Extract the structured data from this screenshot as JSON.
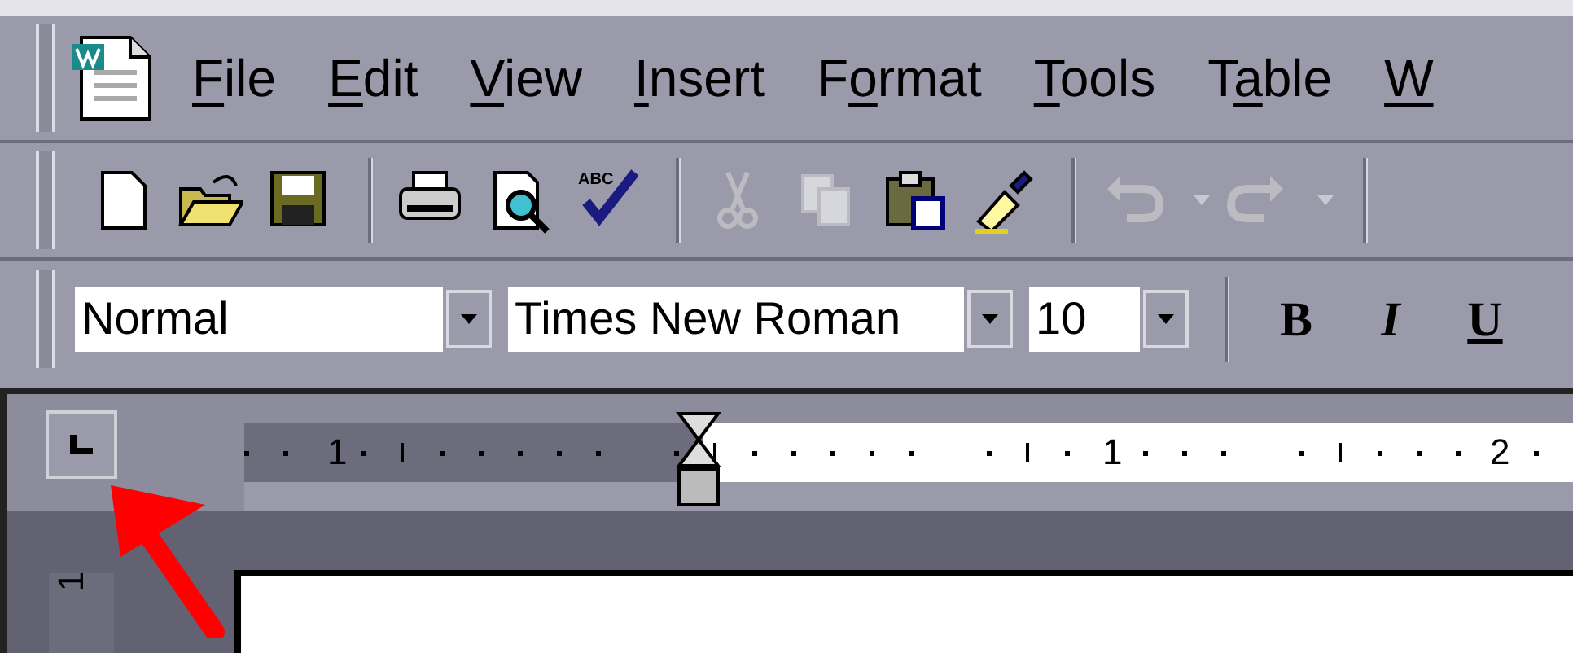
{
  "menu_bar": [
    {
      "key": "F",
      "after": "ile"
    },
    {
      "key": "E",
      "after": "dit"
    },
    {
      "key": "V",
      "after": "iew"
    },
    {
      "key": "I",
      "after": "nsert"
    },
    {
      "before": "F",
      "key": "o",
      "after": "rmat"
    },
    {
      "key": "T",
      "after": "ools"
    },
    {
      "before": "T",
      "key": "a",
      "after": "ble"
    },
    {
      "key": "W"
    }
  ],
  "standard_toolbar": [
    {
      "kind": "new",
      "disabled": false
    },
    {
      "kind": "open",
      "disabled": false
    },
    {
      "kind": "save",
      "disabled": false
    },
    {
      "kind": "separator"
    },
    {
      "kind": "print",
      "disabled": false
    },
    {
      "kind": "preview",
      "disabled": false
    },
    {
      "kind": "spelling",
      "disabled": false,
      "text": "ABC"
    },
    {
      "kind": "separator"
    },
    {
      "kind": "cut",
      "disabled": true
    },
    {
      "kind": "copy",
      "disabled": true
    },
    {
      "kind": "paste",
      "disabled": false
    },
    {
      "kind": "brush",
      "disabled": false
    },
    {
      "kind": "separator"
    },
    {
      "kind": "undo",
      "disabled": true
    },
    {
      "kind": "dropdown",
      "disabled": true
    },
    {
      "kind": "redo",
      "disabled": true
    },
    {
      "kind": "dropdown",
      "disabled": true
    },
    {
      "kind": "separator"
    }
  ],
  "formatting_toolbar": {
    "style": "Normal",
    "font": "Times New Roman",
    "size": "10",
    "buttons": [
      {
        "kind": "bold",
        "label": "B"
      },
      {
        "kind": "italic",
        "label": "I"
      },
      {
        "kind": "underline",
        "label": "U"
      }
    ]
  },
  "ruler": {
    "labels": [
      "1",
      "1",
      "2"
    ],
    "vertical_label": "1"
  },
  "annotations": [
    {
      "kind": "arrow"
    }
  ]
}
